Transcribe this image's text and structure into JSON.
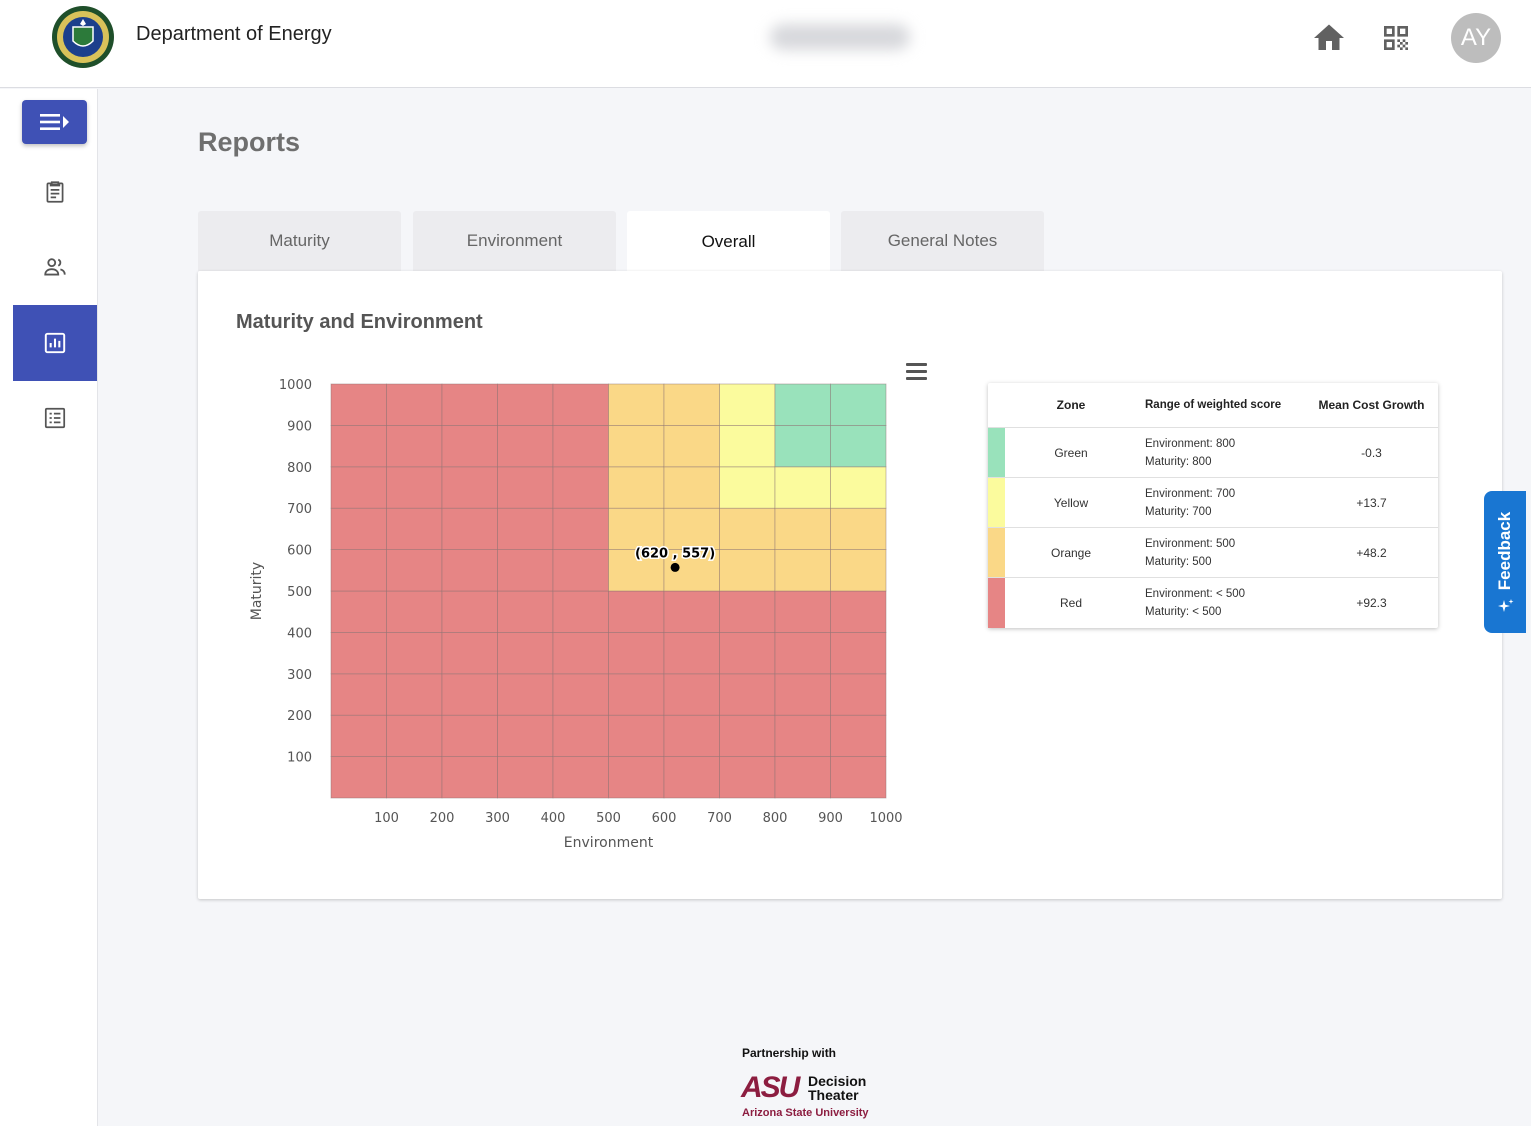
{
  "header": {
    "org_name": "Department of Energy",
    "avatar_initials": "AY"
  },
  "sidebar": {
    "items": [
      {
        "name": "assessments",
        "icon": "clipboard-icon",
        "active": false
      },
      {
        "name": "users",
        "icon": "people-icon",
        "active": false
      },
      {
        "name": "reports",
        "icon": "bar-chart-icon",
        "active": true
      },
      {
        "name": "list",
        "icon": "list-icon",
        "active": false
      }
    ]
  },
  "page": {
    "title": "Reports"
  },
  "tabs": [
    {
      "label": "Maturity",
      "active": false
    },
    {
      "label": "Environment",
      "active": false
    },
    {
      "label": "Overall",
      "active": true
    },
    {
      "label": "General Notes",
      "active": false
    }
  ],
  "card": {
    "title": "Maturity and Environment"
  },
  "chart_data": {
    "type": "heatmap",
    "title": "",
    "xlabel": "Environment",
    "ylabel": "Maturity",
    "xlim": [
      0,
      1000
    ],
    "ylim": [
      0,
      1000
    ],
    "x_ticks": [
      100,
      200,
      300,
      400,
      500,
      600,
      700,
      800,
      900,
      1000
    ],
    "y_ticks": [
      100,
      200,
      300,
      400,
      500,
      600,
      700,
      800,
      900,
      1000
    ],
    "grid": true,
    "cell_size": 100,
    "zones": [
      {
        "name": "Red",
        "color": "#e68585",
        "region": "Environment < 500 or Maturity < 500"
      },
      {
        "name": "Orange",
        "color": "#fad887",
        "region": "Environment >= 500 and Maturity >= 500"
      },
      {
        "name": "Yellow",
        "color": "#fbfb9d",
        "region": "Environment >= 700 and Maturity >= 700"
      },
      {
        "name": "Green",
        "color": "#99e2bb",
        "region": "Environment >= 800 and Maturity >= 800"
      }
    ],
    "point": {
      "x": 620,
      "y": 557,
      "label": "(620 , 557)"
    },
    "menu_icon": "hamburger-icon"
  },
  "zone_table": {
    "headers": [
      "Zone",
      "Range of weighted score",
      "Mean Cost Growth"
    ],
    "rows": [
      {
        "zone": "Green",
        "color": "#99e2bb",
        "env": "Environment: 800",
        "mat": "Maturity: 800",
        "growth": "-0.3"
      },
      {
        "zone": "Yellow",
        "color": "#fbfb9d",
        "env": "Environment: 700",
        "mat": "Maturity: 700",
        "growth": "+13.7"
      },
      {
        "zone": "Orange",
        "color": "#fad887",
        "env": "Environment: 500",
        "mat": "Maturity: 500",
        "growth": "+48.2"
      },
      {
        "zone": "Red",
        "color": "#e68585",
        "env": "Environment: < 500",
        "mat": "Maturity: < 500",
        "growth": "+92.3"
      }
    ]
  },
  "feedback": {
    "label": "Feedback"
  },
  "footer": {
    "partnership": "Partnership with",
    "logo_mark": "ASU",
    "logo_line1": "Decision",
    "logo_line2": "Theater",
    "logo_university": "Arizona State University"
  },
  "colors": {
    "primary": "#3f51b5",
    "feedback": "#1976d2",
    "asu_maroon": "#8c1d40"
  }
}
